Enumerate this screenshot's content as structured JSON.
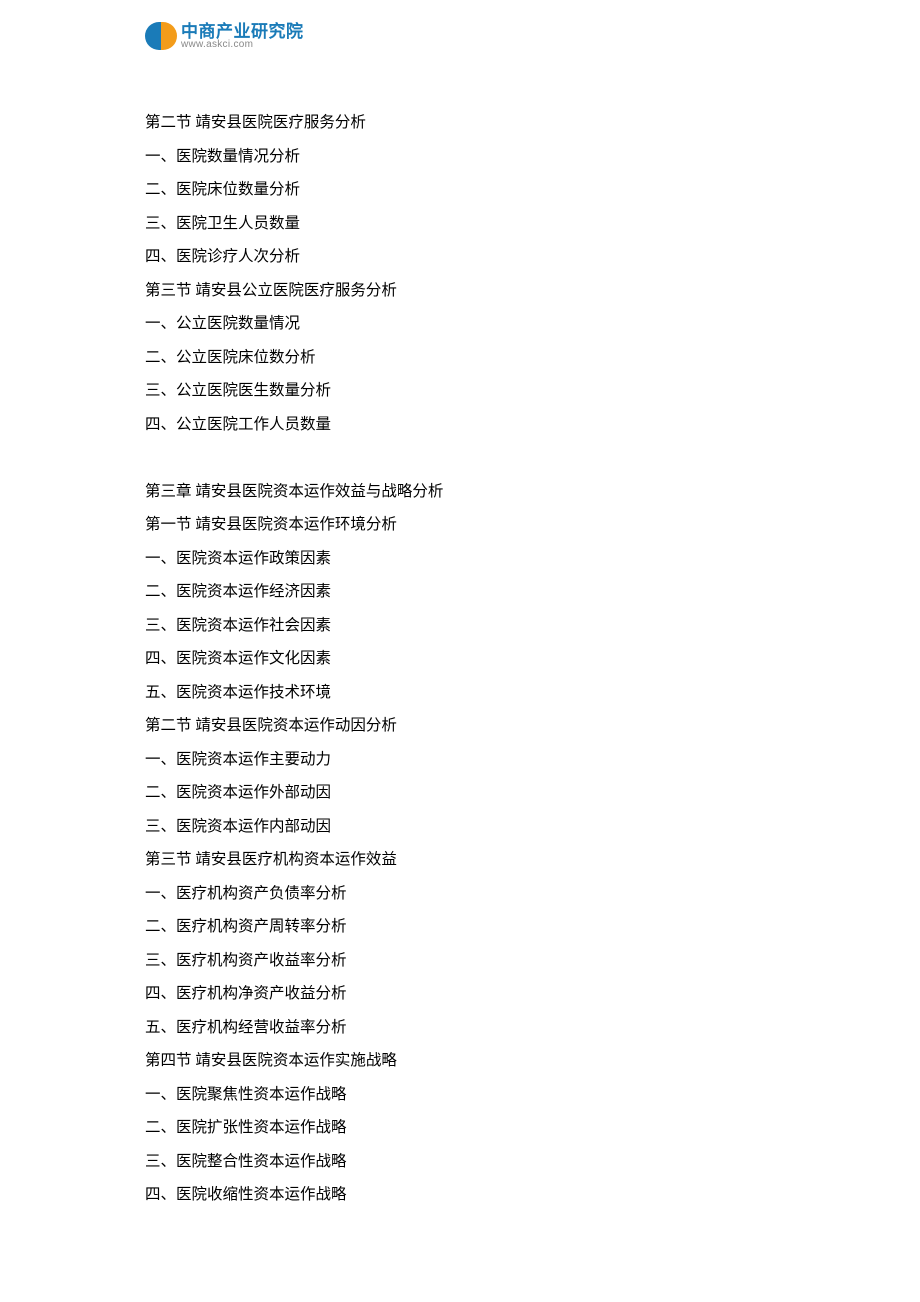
{
  "logo": {
    "cn": "中商产业研究院",
    "url": "www.askci.com"
  },
  "lines": [
    "第二节 靖安县医院医疗服务分析",
    "一、医院数量情况分析",
    "二、医院床位数量分析",
    "三、医院卫生人员数量",
    "四、医院诊疗人次分析",
    "第三节 靖安县公立医院医疗服务分析",
    "一、公立医院数量情况",
    "二、公立医院床位数分析",
    "三、公立医院医生数量分析",
    "四、公立医院工作人员数量",
    "",
    "第三章 靖安县医院资本运作效益与战略分析",
    "第一节 靖安县医院资本运作环境分析",
    "一、医院资本运作政策因素",
    "二、医院资本运作经济因素",
    "三、医院资本运作社会因素",
    "四、医院资本运作文化因素",
    "五、医院资本运作技术环境",
    "第二节 靖安县医院资本运作动因分析",
    "一、医院资本运作主要动力",
    "二、医院资本运作外部动因",
    "三、医院资本运作内部动因",
    "第三节 靖安县医疗机构资本运作效益",
    "一、医疗机构资产负债率分析",
    "二、医疗机构资产周转率分析",
    "三、医疗机构资产收益率分析",
    "四、医疗机构净资产收益分析",
    "五、医疗机构经营收益率分析",
    "第四节 靖安县医院资本运作实施战略",
    "一、医院聚焦性资本运作战略",
    "二、医院扩张性资本运作战略",
    "三、医院整合性资本运作战略",
    "四、医院收缩性资本运作战略"
  ]
}
